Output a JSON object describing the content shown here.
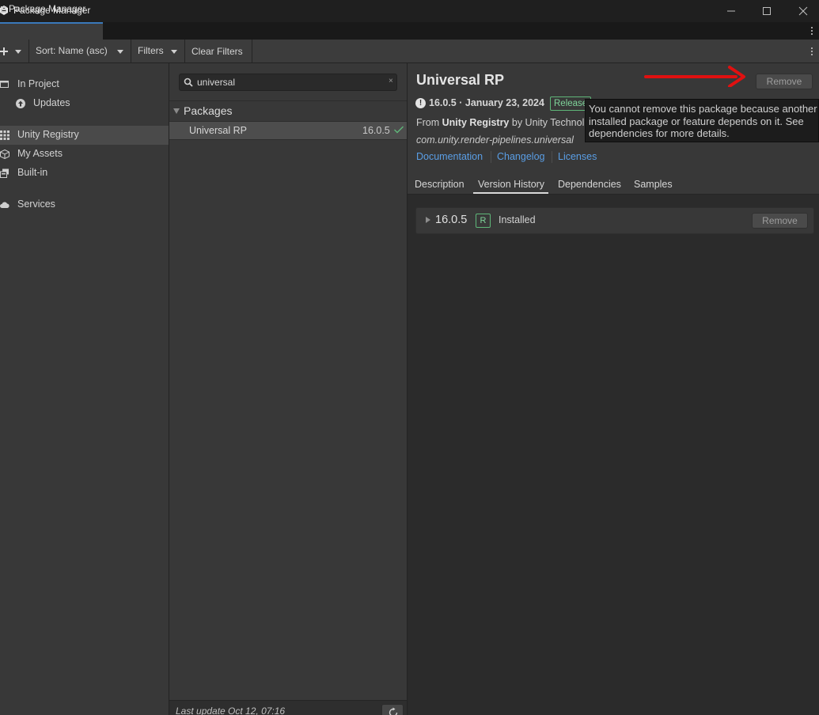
{
  "window": {
    "title": "Package Manager"
  },
  "tab": {
    "label": "Package Manager"
  },
  "toolbar": {
    "sort_label": "Sort: Name (asc)",
    "filters_label": "Filters",
    "clear_filters_label": "Clear Filters"
  },
  "sidebar": {
    "items": [
      {
        "label": "In Project",
        "icon": "project-icon"
      },
      {
        "label": "Updates",
        "icon": "update-arrow-icon"
      },
      {
        "label": "Unity Registry",
        "icon": "grid-icon",
        "selected": true
      },
      {
        "label": "My Assets",
        "icon": "cube-icon"
      },
      {
        "label": "Built-in",
        "icon": "builtin-icon"
      },
      {
        "label": "Services",
        "icon": "cloud-icon"
      }
    ]
  },
  "list": {
    "search_value": "universal",
    "group_label": "Packages",
    "packages": [
      {
        "name": "Universal RP",
        "version": "16.0.5",
        "installed": true
      }
    ],
    "last_update": "Last update Oct 12, 07:16"
  },
  "detail": {
    "title": "Universal RP",
    "remove_label": "Remove",
    "version_date": "16.0.5 · January 23, 2024",
    "release_badge": "Release",
    "from_prefix": "From ",
    "from_source": "Unity Registry",
    "from_by": " by Unity Technol",
    "package_id": "com.unity.render-pipelines.universal",
    "links": [
      "Documentation",
      "Changelog",
      "Licenses"
    ],
    "tooltip": "You cannot remove this package because another installed package or feature depends on it. See dependencies for more details.",
    "tabs": [
      "Description",
      "Version History",
      "Dependencies",
      "Samples"
    ],
    "active_tab": "Version History",
    "versions": [
      {
        "version": "16.0.5",
        "badge": "R",
        "status": "Installed",
        "action": "Remove"
      }
    ]
  },
  "colors": {
    "accent_blue": "#3a79bb",
    "link_blue": "#5a9ee5",
    "release_green": "#5fb779",
    "annotation_red": "#e01010"
  }
}
